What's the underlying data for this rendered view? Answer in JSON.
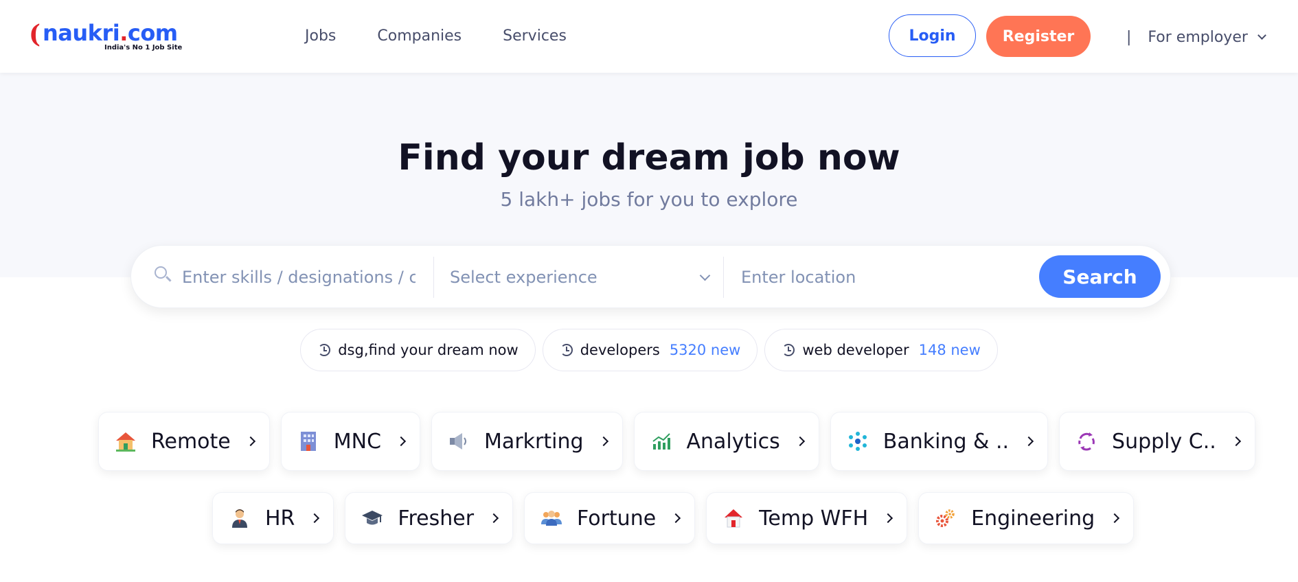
{
  "header": {
    "logo": {
      "brand": "naukri",
      "dot": ".",
      "tld": "com",
      "tagline": "India's No 1 Job Site"
    },
    "nav": [
      {
        "label": "Jobs"
      },
      {
        "label": "Companies"
      },
      {
        "label": "Services"
      }
    ],
    "login_label": "Login",
    "register_label": "Register",
    "separator": "|",
    "employer_label": "For employer"
  },
  "hero": {
    "title": "Find your dream job now",
    "subtitle": "5 lakh+ jobs for you to explore"
  },
  "search": {
    "skills_placeholder": "Enter skills / designations / companies",
    "experience_placeholder": "Select experience",
    "location_placeholder": "Enter location",
    "button_label": "Search"
  },
  "recent_searches": [
    {
      "text": "dsg,find your dream now",
      "count": ""
    },
    {
      "text": "developers",
      "count": "5320 new"
    },
    {
      "text": "web developer",
      "count": "148 new"
    }
  ],
  "categories_row1": [
    {
      "label": "Remote",
      "icon": "house-icon"
    },
    {
      "label": "MNC",
      "icon": "building-icon"
    },
    {
      "label": "Markrting",
      "icon": "speaker-icon"
    },
    {
      "label": "Analytics",
      "icon": "chart-icon"
    },
    {
      "label": "Banking & ..",
      "icon": "network-icon"
    },
    {
      "label": "Supply C..",
      "icon": "cycle-icon"
    }
  ],
  "categories_row2": [
    {
      "label": "HR",
      "icon": "person-icon"
    },
    {
      "label": "Fresher",
      "icon": "graduation-cap-icon"
    },
    {
      "label": "Fortune",
      "icon": "group-icon"
    },
    {
      "label": "Temp WFH",
      "icon": "home-icon"
    },
    {
      "label": "Engineering",
      "icon": "gears-icon"
    }
  ],
  "colors": {
    "brand_blue": "#275df5",
    "search_blue": "#457eff",
    "register_orange": "#ff7555",
    "logo_red": "#e2252b",
    "hero_bg": "#f7f8fc"
  }
}
